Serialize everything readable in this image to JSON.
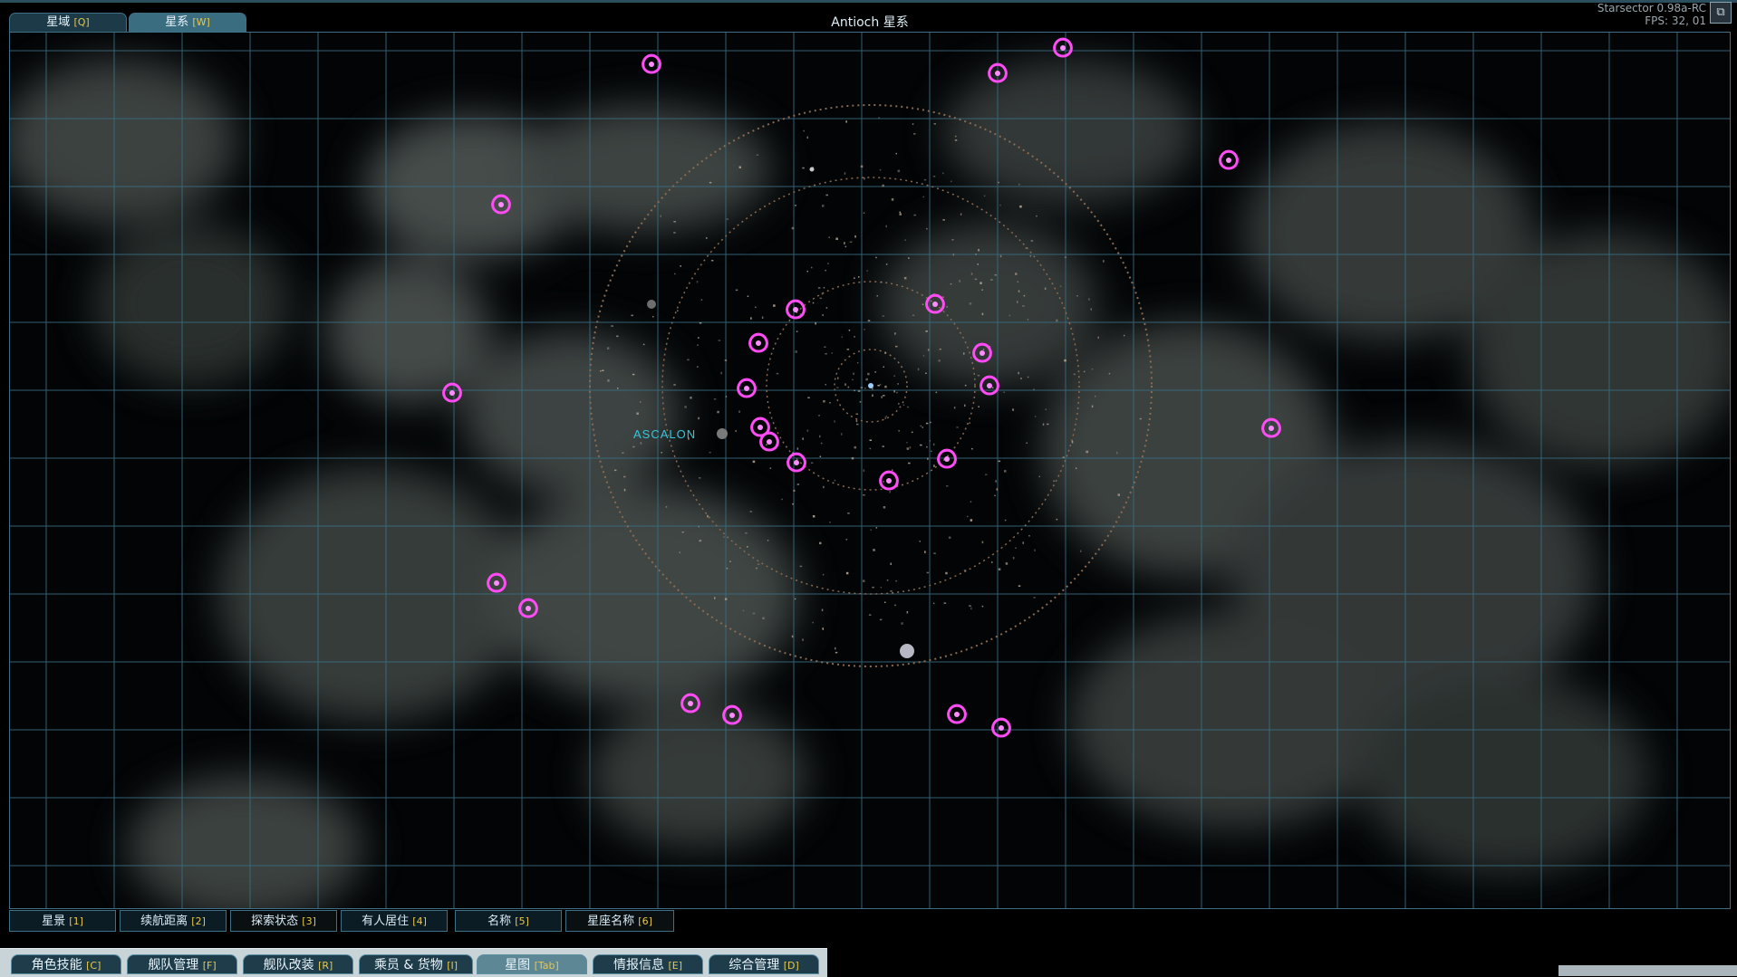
{
  "top_tabs": [
    {
      "label": "星域",
      "key": "[Q]"
    },
    {
      "label": "星系",
      "key": "[W]"
    }
  ],
  "map_title": "Antioch 星系",
  "perf": {
    "line1": "Starsector 0.98a-RC",
    "line2": "FPS: 32, 01"
  },
  "corner_icon": "menu-toggle-icon",
  "planet_label": "ASCALON",
  "colors": {
    "grid": "#3a6f86",
    "orbit": "#8a6a52",
    "vortex": "#e230e0",
    "label": "#38c6d8",
    "accent_key": "#e7c84a"
  },
  "layer_buttons": [
    {
      "label": "星景",
      "key": "[1]"
    },
    {
      "label": "续航距离",
      "key": "[2]"
    },
    {
      "label": "探索状态",
      "key": "[3]"
    },
    {
      "label": "有人居住",
      "key": "[4]"
    },
    {
      "label": "名称",
      "key": "[5]"
    },
    {
      "label": "星座名称",
      "key": "[6]"
    }
  ],
  "bottom_tabs": [
    {
      "label": "角色技能",
      "key": "[C]"
    },
    {
      "label": "舰队管理",
      "key": "[F]"
    },
    {
      "label": "舰队改装",
      "key": "[R]"
    },
    {
      "label": "乘员 & 货物",
      "key": "[I]"
    },
    {
      "label": "星图",
      "key": "[Tab]"
    },
    {
      "label": "情报信息",
      "key": "[E]"
    },
    {
      "label": "综合管理",
      "key": "[D]"
    }
  ]
}
